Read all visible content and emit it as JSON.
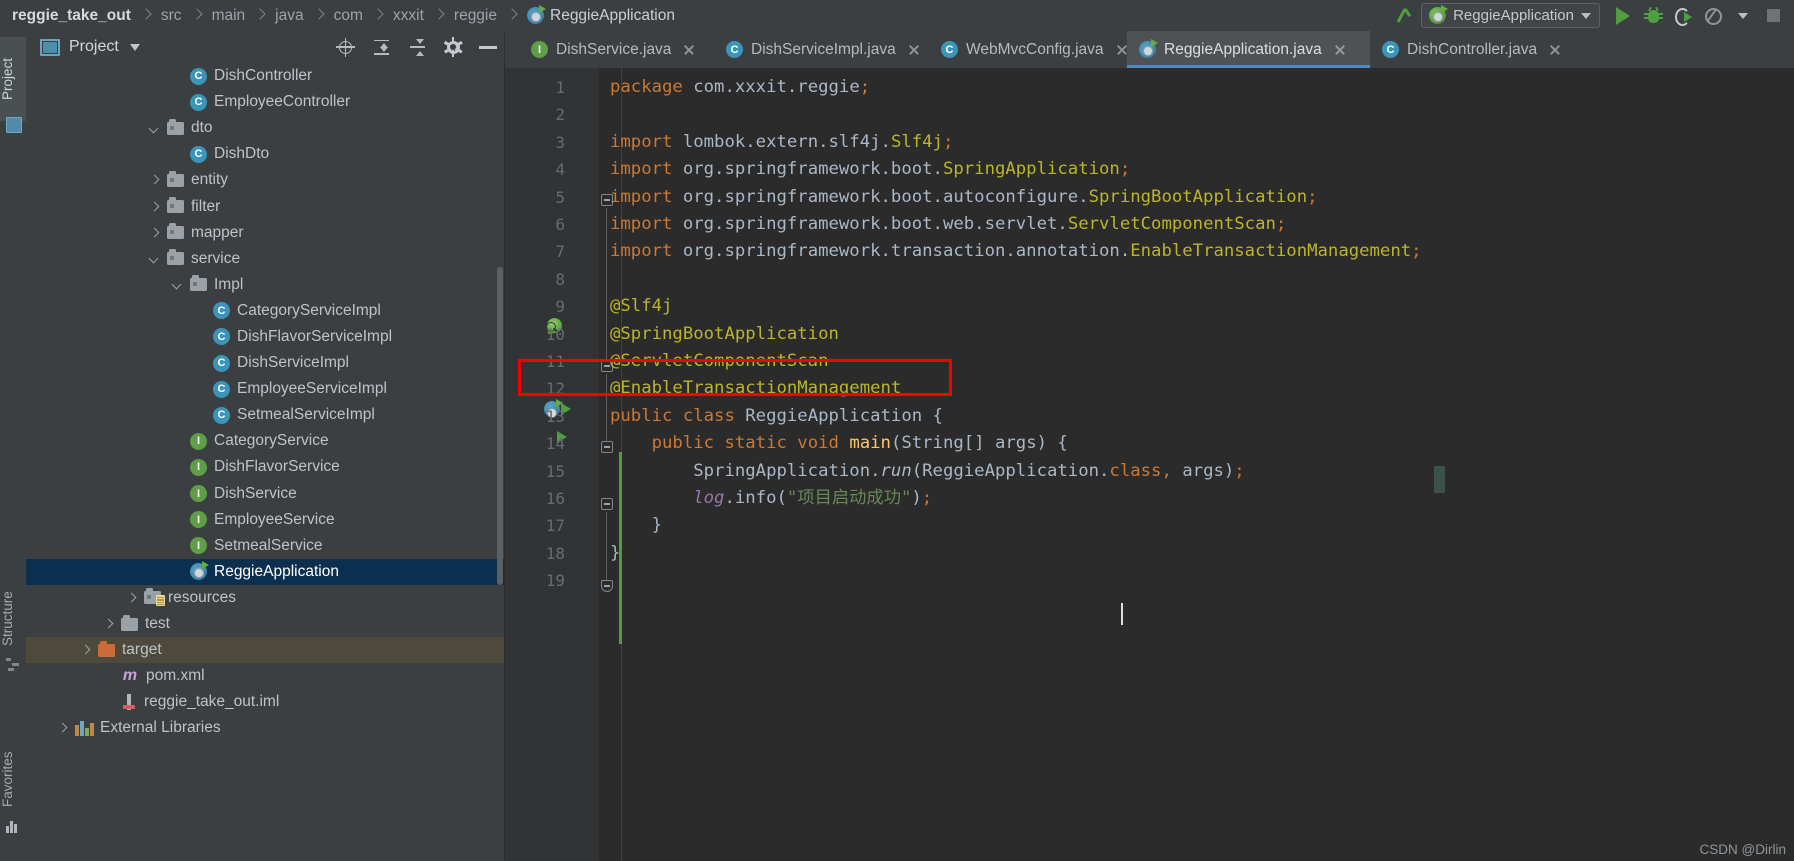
{
  "window": {
    "breadcrumb": [
      {
        "label": "reggie_take_out",
        "bold": true
      },
      {
        "label": "src",
        "bold": false
      },
      {
        "label": "main",
        "bold": false
      },
      {
        "label": "java",
        "bold": false
      },
      {
        "label": "com",
        "bold": false
      },
      {
        "label": "xxxit",
        "bold": false
      },
      {
        "label": "reggie",
        "bold": false
      },
      {
        "label": "ReggieApplication",
        "bold": false,
        "icon": "spring-boot-icon"
      }
    ]
  },
  "toolbar": {
    "build_icon": "hammer-icon",
    "run_config": {
      "name": "ReggieApplication",
      "icon": "spring-boot-icon",
      "caret": "chevron-down-icon"
    },
    "run_label": "Run",
    "debug_label": "Debug",
    "rerun_label": "Run with Coverage",
    "profile_label": "Profile",
    "stop_label": "Stop"
  },
  "left_strip": {
    "project_tab": "Project",
    "structure_tab": "Structure",
    "favorites_tab": "Favorites"
  },
  "project_panel": {
    "title": "Project",
    "icons": [
      "locate-icon",
      "expand-all-icon",
      "collapse-all-icon",
      "gear-icon",
      "minimize-icon"
    ],
    "tree": [
      {
        "label": "DishController",
        "type": "class",
        "indent": 6,
        "arrow": "none"
      },
      {
        "label": "EmployeeController",
        "type": "class",
        "indent": 6,
        "arrow": "none"
      },
      {
        "label": "dto",
        "type": "folder",
        "indent": 5,
        "arrow": "down"
      },
      {
        "label": "DishDto",
        "type": "class",
        "indent": 6,
        "arrow": "none"
      },
      {
        "label": "entity",
        "type": "folder",
        "indent": 5,
        "arrow": "right"
      },
      {
        "label": "filter",
        "type": "folder",
        "indent": 5,
        "arrow": "right"
      },
      {
        "label": "mapper",
        "type": "folder",
        "indent": 5,
        "arrow": "right"
      },
      {
        "label": "service",
        "type": "folder",
        "indent": 5,
        "arrow": "down"
      },
      {
        "label": "Impl",
        "type": "folder",
        "indent": 6,
        "arrow": "down"
      },
      {
        "label": "CategoryServiceImpl",
        "type": "class",
        "indent": 7,
        "arrow": "none"
      },
      {
        "label": "DishFlavorServiceImpl",
        "type": "class",
        "indent": 7,
        "arrow": "none"
      },
      {
        "label": "DishServiceImpl",
        "type": "class",
        "indent": 7,
        "arrow": "none"
      },
      {
        "label": "EmployeeServiceImpl",
        "type": "class",
        "indent": 7,
        "arrow": "none"
      },
      {
        "label": "SetmealServiceImpl",
        "type": "class",
        "indent": 7,
        "arrow": "none"
      },
      {
        "label": "CategoryService",
        "type": "interface",
        "indent": 6,
        "arrow": "none"
      },
      {
        "label": "DishFlavorService",
        "type": "interface",
        "indent": 6,
        "arrow": "none"
      },
      {
        "label": "DishService",
        "type": "interface",
        "indent": 6,
        "arrow": "none"
      },
      {
        "label": "EmployeeService",
        "type": "interface",
        "indent": 6,
        "arrow": "none"
      },
      {
        "label": "SetmealService",
        "type": "interface",
        "indent": 6,
        "arrow": "none"
      },
      {
        "label": "ReggieApplication",
        "type": "spring",
        "indent": 6,
        "arrow": "none",
        "selected": true
      },
      {
        "label": "resources",
        "type": "resources-folder",
        "indent": 4,
        "arrow": "right"
      },
      {
        "label": "test",
        "type": "plain-folder",
        "indent": 3,
        "arrow": "right"
      },
      {
        "label": "target",
        "type": "orange-folder",
        "indent": 2,
        "arrow": "right",
        "highlighted": true
      },
      {
        "label": "pom.xml",
        "type": "maven",
        "indent": 3,
        "arrow": "none"
      },
      {
        "label": "reggie_take_out.iml",
        "type": "iml",
        "indent": 3,
        "arrow": "none"
      },
      {
        "label": "External Libraries",
        "type": "library",
        "indent": 1,
        "arrow": "right"
      }
    ]
  },
  "editor": {
    "tabs": [
      {
        "label": "DishService.java",
        "icon": "interface-icon",
        "active": false,
        "closable": true
      },
      {
        "label": "DishServiceImpl.java",
        "icon": "class-icon",
        "active": false,
        "closable": true
      },
      {
        "label": "WebMvcConfig.java",
        "icon": "class-icon",
        "active": false,
        "closable": true
      },
      {
        "label": "ReggieApplication.java",
        "icon": "spring-boot-icon",
        "active": true,
        "closable": true
      },
      {
        "label": "DishController.java",
        "icon": "class-icon",
        "active": false,
        "closable": true
      }
    ],
    "lines": [
      {
        "num": "1",
        "text": "package com.xxxit.reggie;"
      },
      {
        "num": "2",
        "text": ""
      },
      {
        "num": "3",
        "text": "import lombok.extern.slf4j.Slf4j;"
      },
      {
        "num": "4",
        "text": "import org.springframework.boot.SpringApplication;"
      },
      {
        "num": "5",
        "text": "import org.springframework.boot.autoconfigure.SpringBootApplication;"
      },
      {
        "num": "6",
        "text": "import org.springframework.boot.web.servlet.ServletComponentScan;"
      },
      {
        "num": "7",
        "text": "import org.springframework.transaction.annotation.EnableTransactionManagement;"
      },
      {
        "num": "8",
        "text": ""
      },
      {
        "num": "9",
        "text": "@Slf4j"
      },
      {
        "num": "10",
        "text": "@SpringBootApplication"
      },
      {
        "num": "11",
        "text": "@ServletComponentScan"
      },
      {
        "num": "12",
        "text": "@EnableTransactionManagement"
      },
      {
        "num": "13",
        "text": "public class ReggieApplication {"
      },
      {
        "num": "14",
        "text": "    public static void main(String[] args) {"
      },
      {
        "num": "15",
        "text": "        SpringApplication.run(ReggieApplication.class, args);"
      },
      {
        "num": "16",
        "text": "        log.info(\"项目启动成功\");"
      },
      {
        "num": "17",
        "text": "    }"
      },
      {
        "num": "18",
        "text": "}"
      },
      {
        "num": "19",
        "text": ""
      }
    ],
    "annotation_box": {
      "color": "#f40000",
      "targets_line": "12",
      "target_text": "@EnableTransactionManagement"
    }
  },
  "watermark": "CSDN @Dirlin"
}
